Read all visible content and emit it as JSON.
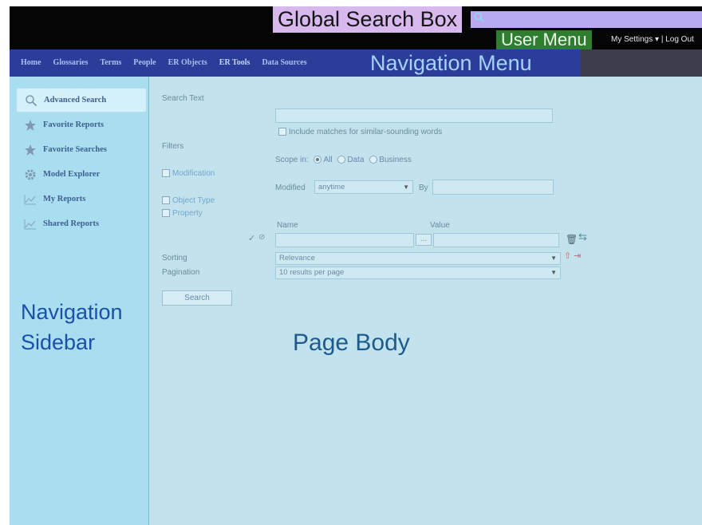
{
  "header": {
    "global_search_label": "Global Search Box",
    "user_menu_label": "User Menu",
    "my_settings": "My Settings ▾",
    "separator": " | ",
    "logout": "Log Out"
  },
  "nav": {
    "items": [
      "Home",
      "Glossaries",
      "Terms",
      "People",
      "ER Objects",
      "ER Tools",
      "Data Sources"
    ],
    "active": "ER Tools",
    "label": "Navigation Menu"
  },
  "sidebar": {
    "items": [
      {
        "label": "Advanced Search",
        "icon": "search-icon"
      },
      {
        "label": "Favorite Reports",
        "icon": "star-icon"
      },
      {
        "label": "Favorite Searches",
        "icon": "star-icon"
      },
      {
        "label": "Model Explorer",
        "icon": "gear-icon"
      },
      {
        "label": "My Reports",
        "icon": "chart-icon"
      },
      {
        "label": "Shared Reports",
        "icon": "chart-icon"
      }
    ],
    "note_line1": "Navigation",
    "note_line2": "Sidebar"
  },
  "form": {
    "search_text_label": "Search Text",
    "search_text_value": "",
    "similar_sounding_label": "Include matches for similar-sounding words",
    "filters_label": "Filters",
    "scope_label": "Scope in:",
    "scope_options": [
      "All",
      "Data",
      "Business"
    ],
    "scope_selected": "All",
    "modification_link": "Modification",
    "modified_label": "Modified",
    "modified_value": "anytime",
    "by_label": "By",
    "by_value": "",
    "object_type_link": "Object Type",
    "property_link": "Property",
    "name_label": "Name",
    "value_label": "Value",
    "browse_button": "...",
    "sorting_label": "Sorting",
    "sorting_value": "Relevance",
    "pagination_label": "Pagination",
    "pagination_value": "10 results per page",
    "search_button": "Search"
  },
  "body_note": "Page Body",
  "colors": {
    "header_bg": "#050505",
    "nav_bg": "#2a3d98",
    "sidebar_bg": "#a9def0",
    "body_bg": "#c2e2ee"
  }
}
